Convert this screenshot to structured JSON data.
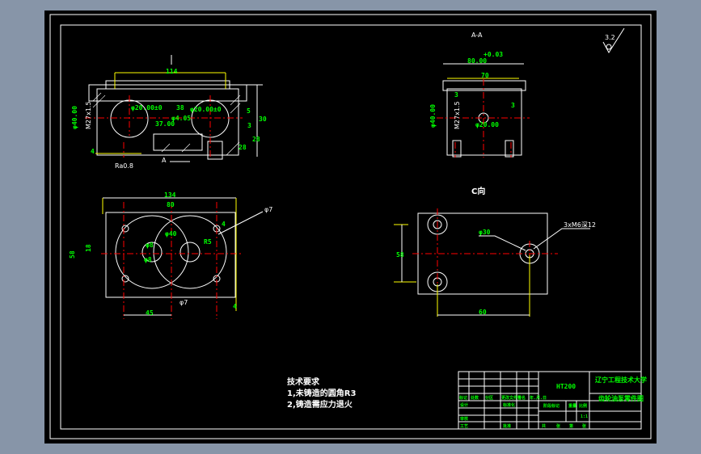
{
  "drawing": {
    "section_label": "A-A",
    "view_label": "C向",
    "roughness_symbol": "3.2",
    "colors": {
      "background": "#8795a8",
      "sheet": "#000000",
      "lines": "#ffffff",
      "dimensions": "#00ff00",
      "centerlines": "#ff0000",
      "extension_lines": "#ffff00"
    },
    "front_view": {
      "dims": [
        "114",
        "φ40.00",
        "M27x1.5",
        "φ20.00±0",
        "φ20.00±0",
        "37.00",
        "38",
        "φ4.05",
        "5",
        "3",
        "28",
        "30",
        "28",
        "4",
        "Ra0.8",
        "A"
      ]
    },
    "section_view": {
      "dims": [
        "80.00",
        "+0.03",
        "70",
        "3",
        "φ40.00",
        "M27x1.5",
        "φ20.00",
        "3"
      ]
    },
    "top_view": {
      "dims": [
        "134",
        "80",
        "φ7",
        "4",
        "φ40",
        "φ8",
        "φ8",
        "R5",
        "18",
        "58",
        "φ7",
        "45",
        "4"
      ]
    },
    "c_view": {
      "dims": [
        "φ30",
        "3xM6深12",
        "58",
        "60"
      ]
    },
    "tech_requirements": {
      "title": "技术要求",
      "items": [
        "1,未铸造的圆角R3",
        "2,铸造需应力退火"
      ]
    },
    "title_block": {
      "material": "HT200",
      "school": "辽宁工程技术大学",
      "part_name": "齿轮油泵零件图",
      "row_labels": [
        "标记",
        "处数",
        "分区",
        "更改文件号",
        "签名",
        "年.月.日"
      ],
      "design_label": "设计",
      "standard_label": "标准化",
      "check_label": "审核",
      "process_label": "工艺",
      "approve_label": "批准",
      "stage_label": "阶段标记",
      "weight_label": "重量",
      "scale_label": "比例",
      "scale_value": "1:1",
      "sheet_labels": [
        "共",
        "张",
        "第",
        "张"
      ]
    }
  }
}
